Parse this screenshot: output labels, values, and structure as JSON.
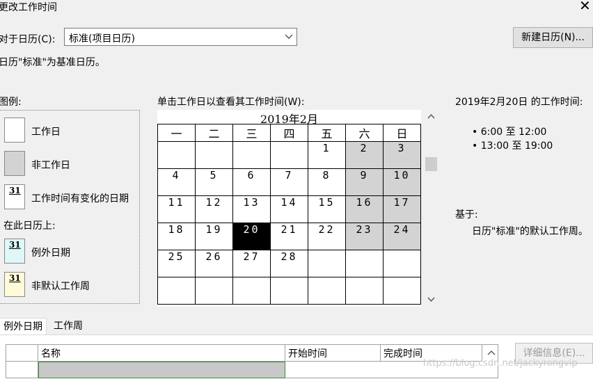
{
  "window": {
    "title": "更改工作时间",
    "close_glyph": "✕"
  },
  "calendar_for": {
    "label": "对于日历(C):",
    "value": "标准(项目日历)"
  },
  "new_calendar_button": "新建日历(N)...",
  "base_note": "日历\"标准\"为基准日历。",
  "legend": {
    "title": "图例:",
    "items": [
      {
        "label": "工作日",
        "icon": "blank-white"
      },
      {
        "label": "非工作日",
        "icon": "gray-fill"
      },
      {
        "label": "工作时间有变化的日期",
        "icon": "31-white"
      }
    ],
    "on_calendar_title": "在此日历上:",
    "calendar_items": [
      {
        "label": "例外日期",
        "icon": "31-cyan"
      },
      {
        "label": "非默认工作周",
        "icon": "31-yellow"
      }
    ],
    "swatch_number": "31",
    "colors": {
      "nonwork": "#d3d3d3",
      "exception": "#dff7f9",
      "nondefault": "#fffbd9"
    }
  },
  "calendar": {
    "instruction": "单击工作日以查看其工作时间(W):",
    "month_title": "2019年2月",
    "weekdays": [
      "一",
      "二",
      "三",
      "四",
      "五",
      "六",
      "日"
    ],
    "weeks": [
      [
        "",
        "",
        "",
        "",
        "1",
        "2",
        "3"
      ],
      [
        "4",
        "5",
        "6",
        "7",
        "8",
        "9",
        "10"
      ],
      [
        "11",
        "12",
        "13",
        "14",
        "15",
        "16",
        "17"
      ],
      [
        "18",
        "19",
        "20",
        "21",
        "22",
        "23",
        "24"
      ],
      [
        "25",
        "26",
        "27",
        "28",
        "",
        "",
        ""
      ],
      [
        "",
        "",
        "",
        "",
        "",
        "",
        ""
      ]
    ],
    "selected_day": "20"
  },
  "working_times": {
    "heading": "2019年2月20日 的工作时间:",
    "times": [
      "6:00 至 12:00",
      "13:00 至 19:00"
    ],
    "based_on_label": "基于:",
    "based_on_text": "日历\"标准\"的默认工作周。"
  },
  "tabs": [
    "例外日期",
    "工作周"
  ],
  "exceptions_table": {
    "columns": [
      "名称",
      "开始时间",
      "完成时间"
    ]
  },
  "details_button": "详细信息(E)...",
  "watermark": "https://blog.csdn.net/jackyrongvip"
}
